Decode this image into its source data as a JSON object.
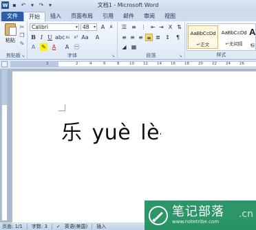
{
  "window": {
    "title": "文档1 - Microsoft Word",
    "app_logo": "W"
  },
  "quick_access": {
    "icons": [
      "save-icon",
      "undo-icon",
      "redo-icon",
      "customize-icon"
    ]
  },
  "ribbon_tabs": [
    {
      "label": "文件",
      "type": "file"
    },
    {
      "label": "开始",
      "active": true
    },
    {
      "label": "插入"
    },
    {
      "label": "页面布局"
    },
    {
      "label": "引用"
    },
    {
      "label": "邮件"
    },
    {
      "label": "审阅"
    },
    {
      "label": "视图"
    }
  ],
  "ribbon": {
    "clipboard": {
      "paste_label": "粘贴",
      "group_label": "剪贴板"
    },
    "font": {
      "font_name": "Calibri",
      "font_size": "48",
      "group_label": "字体"
    },
    "paragraph": {
      "group_label": "段落"
    },
    "styles": {
      "group_label": "样式",
      "cards": [
        {
          "sample": "AaBbCcDd",
          "name": "↵正文",
          "selected": true
        },
        {
          "sample": "AaBbCcDd",
          "name": "↵无间隔",
          "selected": false
        },
        {
          "sample": "Aa",
          "name": "标",
          "selected": false
        }
      ]
    }
  },
  "ruler": {
    "numbers": [
      "2",
      "2",
      "4",
      "6",
      "8",
      "10",
      "12",
      "14",
      "16",
      "18",
      "20",
      "22",
      "24",
      "26"
    ]
  },
  "document": {
    "words": [
      "乐",
      "yuè",
      "lè"
    ]
  },
  "statusbar": {
    "page": "页面: 1/1",
    "words": "字数: 3",
    "language": "英语(美国)",
    "insert": "插入"
  },
  "watermark": {
    "title": "笔记部落",
    "url": "www.notetribe.com",
    "suffix": ".cn"
  },
  "colors": {
    "file_tab": "#2c5fa8",
    "watermark": "#1c8e5c",
    "selected_highlight": "#f5d77a"
  }
}
